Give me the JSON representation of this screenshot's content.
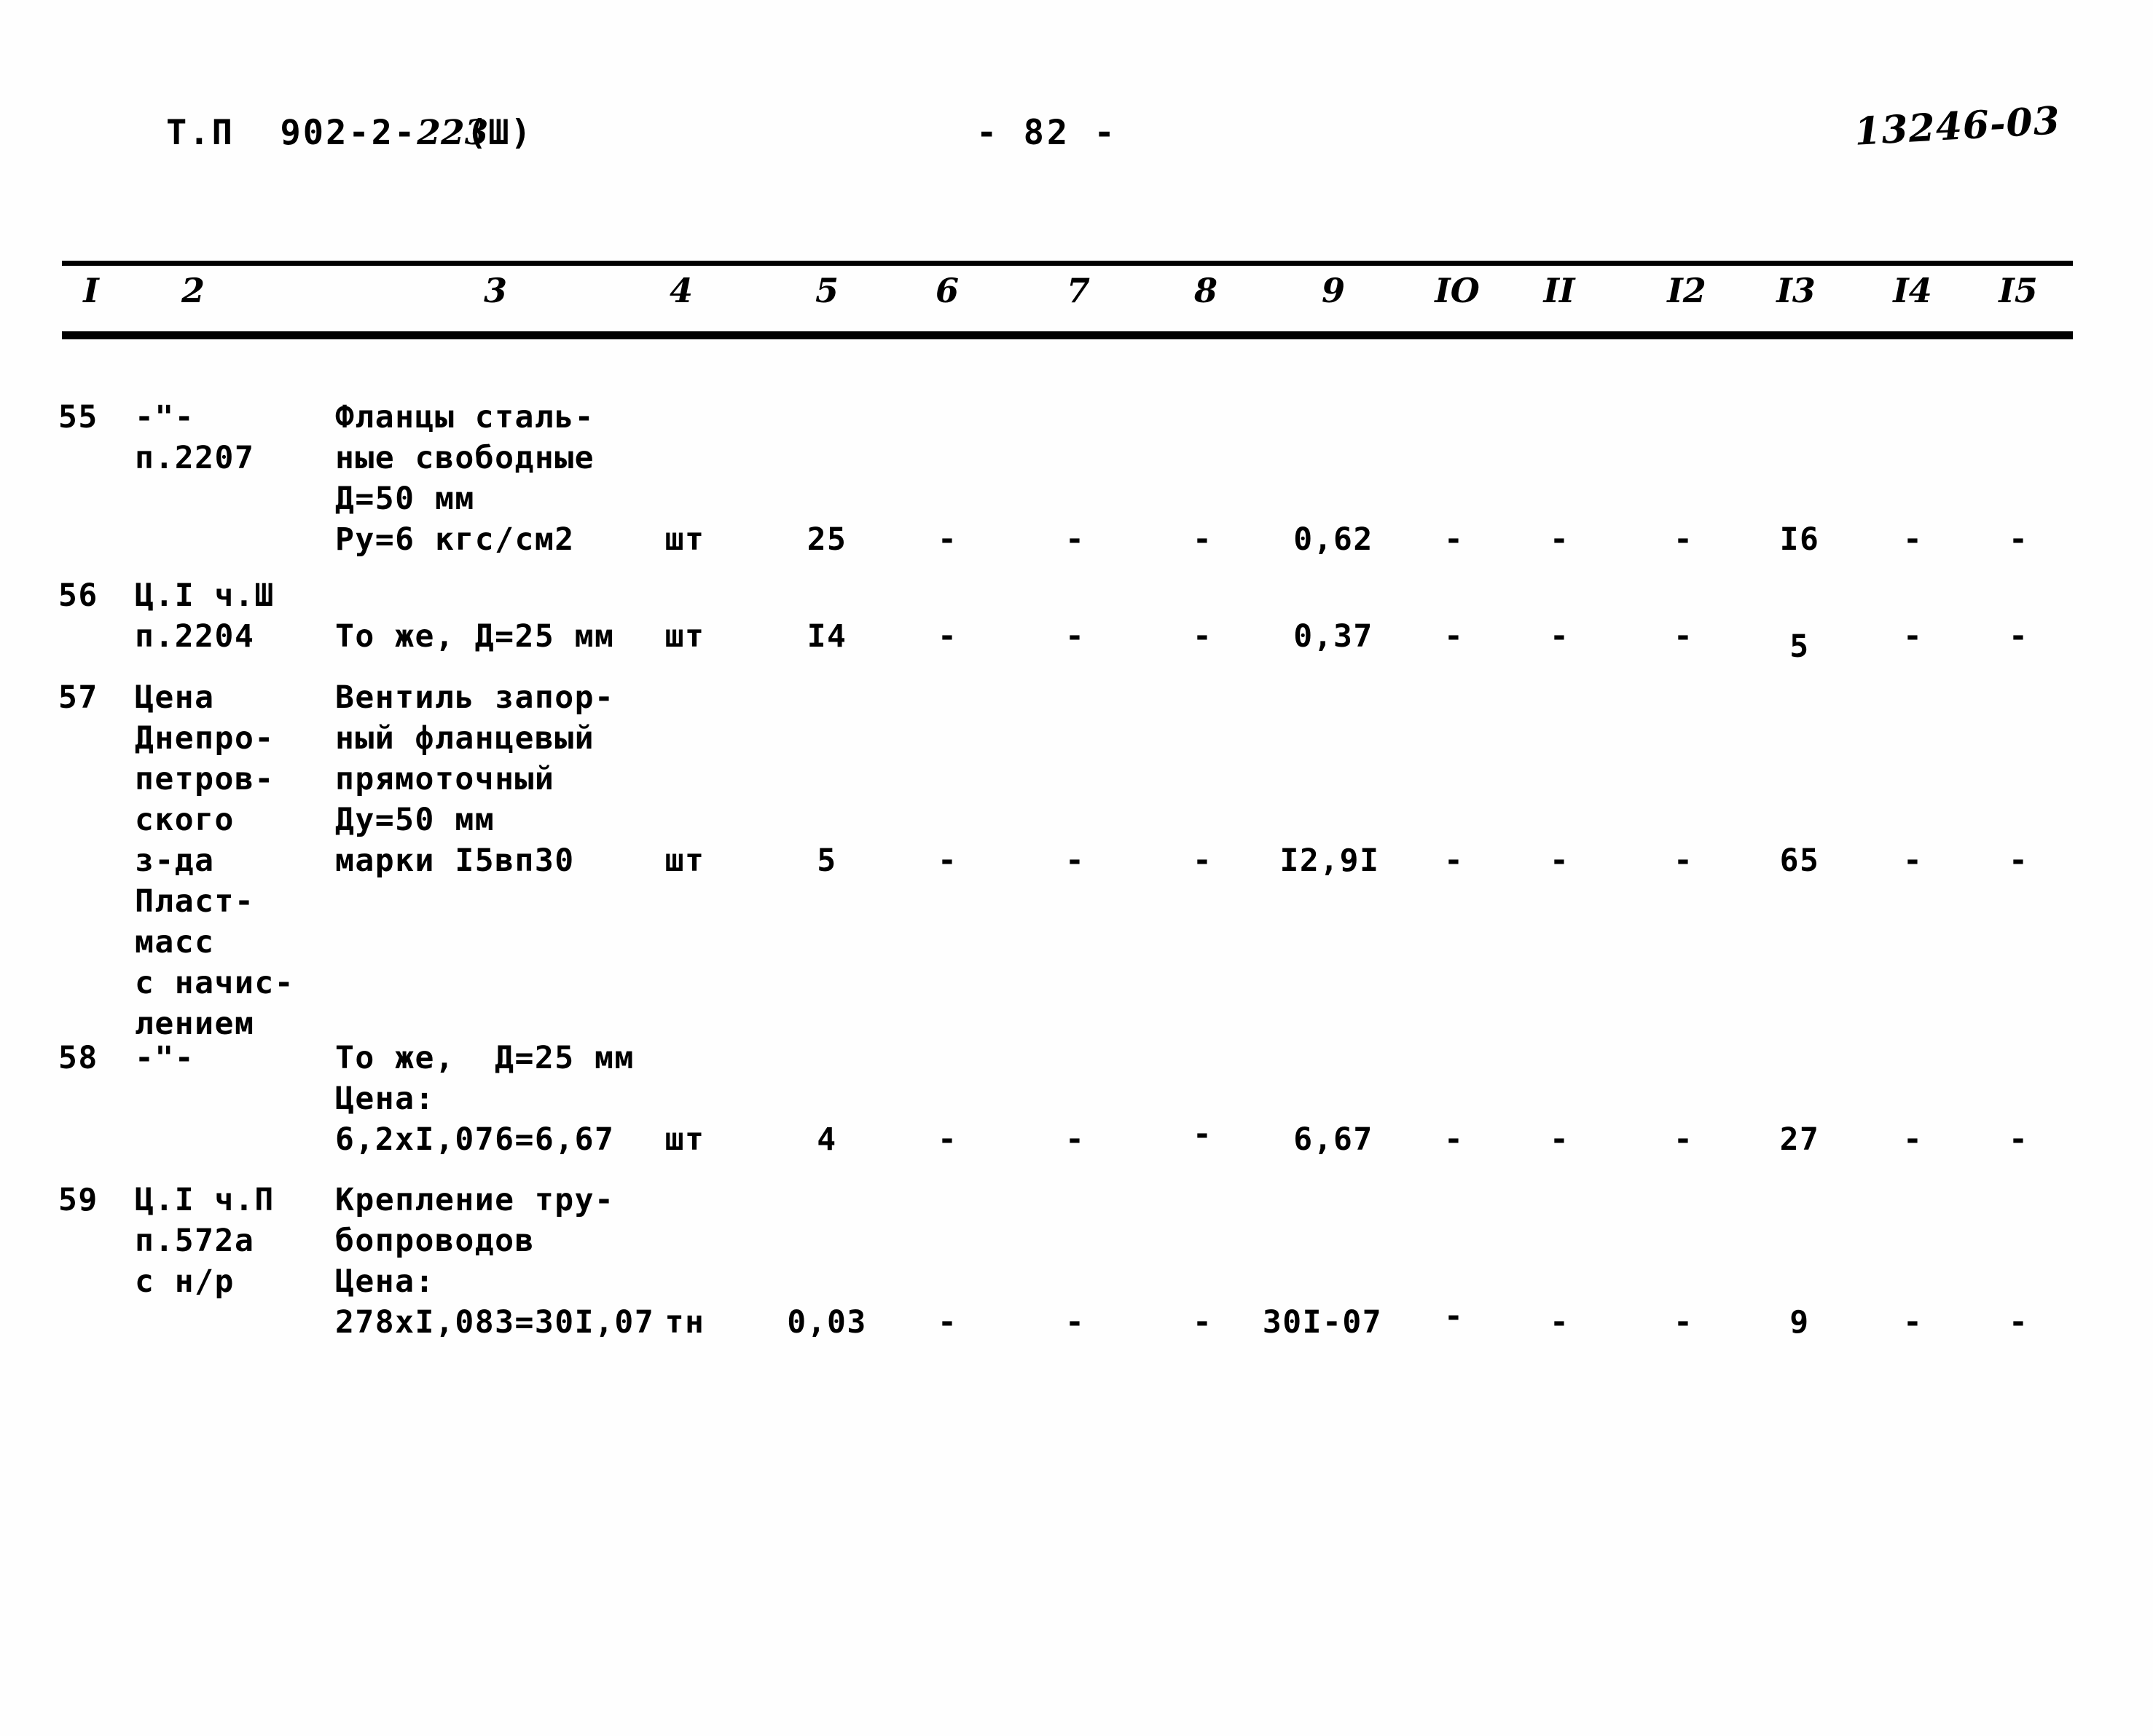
{
  "header": {
    "doc_code": "Т.П  902-2-",
    "doc_code_hand": "223",
    "doc_part": "(Ш)",
    "page_number": "- 82 -",
    "stamp": "13246-03"
  },
  "table": {
    "column_headers": [
      "I",
      "2",
      "3",
      "4",
      "5",
      "6",
      "7",
      "8",
      "9",
      "IO",
      "II",
      "I2",
      "I3",
      "I4",
      "I5"
    ],
    "rows": [
      {
        "c1": "55",
        "c2": "-\"-\nп.2207",
        "c3": "Фланцы сталь-\nные свободные\nД=50 мм\nРу=6 кгс/см2",
        "c4": "шт",
        "c5": "25",
        "c6": "-",
        "c7": "-",
        "c8": "-",
        "c9": "0,62",
        "c10": "-",
        "c11": "-",
        "c12": "-",
        "c13": "I6",
        "c14": "-",
        "c15": "-"
      },
      {
        "c1": "56",
        "c2": "Ц.I ч.Ш\nп.2204",
        "c3": "То же, Д=25 мм",
        "c4": "шт",
        "c5": "I4",
        "c6": "-",
        "c7": "-",
        "c8": "-",
        "c9": "0,37",
        "c10": "-",
        "c11": "-",
        "c12": "-",
        "c13": "5",
        "c14": "-",
        "c15": "-"
      },
      {
        "c1": "57",
        "c2": "Цена\nДнепро-\nпетров-\nского\nз-да\nПласт-\nмасс\nс начис-\nлением",
        "c3": "Вентиль запор-\nный фланцевый\nпрямоточный\nДу=50 мм\nмарки I5вп30",
        "c4": "шт",
        "c5": "5",
        "c6": "-",
        "c7": "-",
        "c8": "-",
        "c9": "I2,9I",
        "c10": "-",
        "c11": "-",
        "c12": "-",
        "c13": "65",
        "c14": "-",
        "c15": "-"
      },
      {
        "c1": "58",
        "c2": "-\"-",
        "c3": "То же,  Д=25 мм\nЦена:\n6,2хI,076=6,67",
        "c4": "шт",
        "c5": "4",
        "c6": "-",
        "c7": "-",
        "c8": "-",
        "c9": "6,67",
        "c10": "-",
        "c11": "-",
        "c12": "-",
        "c13": "27",
        "c14": "-",
        "c15": "-"
      },
      {
        "c1": "59",
        "c2": "Ц.I ч.П\nп.572а\nс н/р",
        "c3": "Крепление тру-\nбопроводов\nЦена:\n278хI,083=30I,07",
        "c4": "тн",
        "c5": "0,03",
        "c6": "-",
        "c7": "-",
        "c8": "-",
        "c9": "30I-07",
        "c10": "-",
        "c11": "-",
        "c12": "-",
        "c13": "9",
        "c14": "-",
        "c15": "-"
      }
    ]
  }
}
